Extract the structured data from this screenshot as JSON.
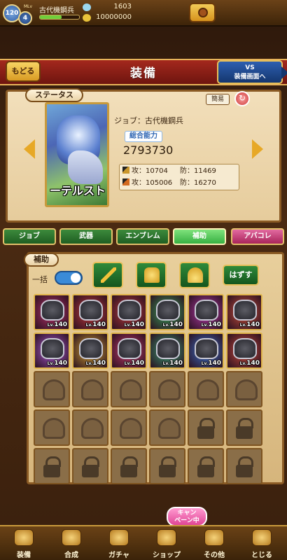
{
  "player": {
    "level": "120",
    "mlv_tag": "MLv",
    "sub_level": "4",
    "name": "古代機鋼兵",
    "exp_fraction": 0.55,
    "gems": "1603",
    "gold": "10000000"
  },
  "header": {
    "back_label": "もどる",
    "title": "装備",
    "vs_line1": "VS",
    "vs_line2": "装備画面へ"
  },
  "status": {
    "section_label": "ステータス",
    "simple_label": "簡易",
    "card_name": "ーテルスト",
    "job_line": "ジョブ：古代機鋼兵",
    "power_label": "総合能力",
    "power_value": "2793730",
    "phys_attack": "攻：10704",
    "phys_defense": "防：11469",
    "mag_attack": "攻：105006",
    "mag_defense": "防：16270"
  },
  "tabs": [
    {
      "label": "ジョブ",
      "active": false
    },
    {
      "label": "武器",
      "active": false
    },
    {
      "label": "エンブレム",
      "active": false
    },
    {
      "label": "補助",
      "active": true
    },
    {
      "label": "アバコレ",
      "active": false
    }
  ],
  "equipment": {
    "section_label": "補助",
    "bulk_label": "一括",
    "bulk_on": true,
    "remove_label": "はずす",
    "filters": [
      "sword-icon",
      "armor-icon",
      "helmet-icon"
    ],
    "lv_prefix": "Lv.",
    "slots": [
      {
        "state": "item",
        "level": "140",
        "tint": "#b8326a"
      },
      {
        "state": "item",
        "level": "140",
        "tint": "#c23a3a"
      },
      {
        "state": "item",
        "level": "140",
        "tint": "#b83a3a"
      },
      {
        "state": "item",
        "level": "140",
        "tint": "#3aa05a"
      },
      {
        "state": "item",
        "level": "140",
        "tint": "#b33aa8"
      },
      {
        "state": "item",
        "level": "140",
        "tint": "#c9503a"
      },
      {
        "state": "item",
        "level": "140",
        "tint": "#a95ad0"
      },
      {
        "state": "item",
        "level": "140",
        "tint": "#d0a030"
      },
      {
        "state": "item",
        "level": "140",
        "tint": "#c23a6a"
      },
      {
        "state": "item",
        "level": "140",
        "tint": "#3a9a70"
      },
      {
        "state": "item",
        "level": "140",
        "tint": "#3a70c8"
      },
      {
        "state": "item",
        "level": "140",
        "tint": "#c84a3a"
      },
      {
        "state": "empty"
      },
      {
        "state": "empty"
      },
      {
        "state": "empty"
      },
      {
        "state": "empty"
      },
      {
        "state": "empty"
      },
      {
        "state": "empty"
      },
      {
        "state": "empty"
      },
      {
        "state": "empty"
      },
      {
        "state": "empty"
      },
      {
        "state": "empty"
      },
      {
        "state": "locked"
      },
      {
        "state": "locked"
      },
      {
        "state": "locked"
      },
      {
        "state": "locked"
      },
      {
        "state": "locked"
      },
      {
        "state": "locked"
      },
      {
        "state": "locked"
      },
      {
        "state": "locked"
      }
    ]
  },
  "campaign": {
    "line1": "キャン",
    "line2": "ペーン中"
  },
  "bottom_nav": [
    {
      "label": "装備",
      "icon": "equip-icon"
    },
    {
      "label": "合成",
      "icon": "hammer-icon"
    },
    {
      "label": "ガチャ",
      "icon": "gacha-icon"
    },
    {
      "label": "ショップ",
      "icon": "shop-icon"
    },
    {
      "label": "その他",
      "icon": "gear-icon"
    },
    {
      "label": "とじる",
      "icon": "close-icon"
    }
  ]
}
